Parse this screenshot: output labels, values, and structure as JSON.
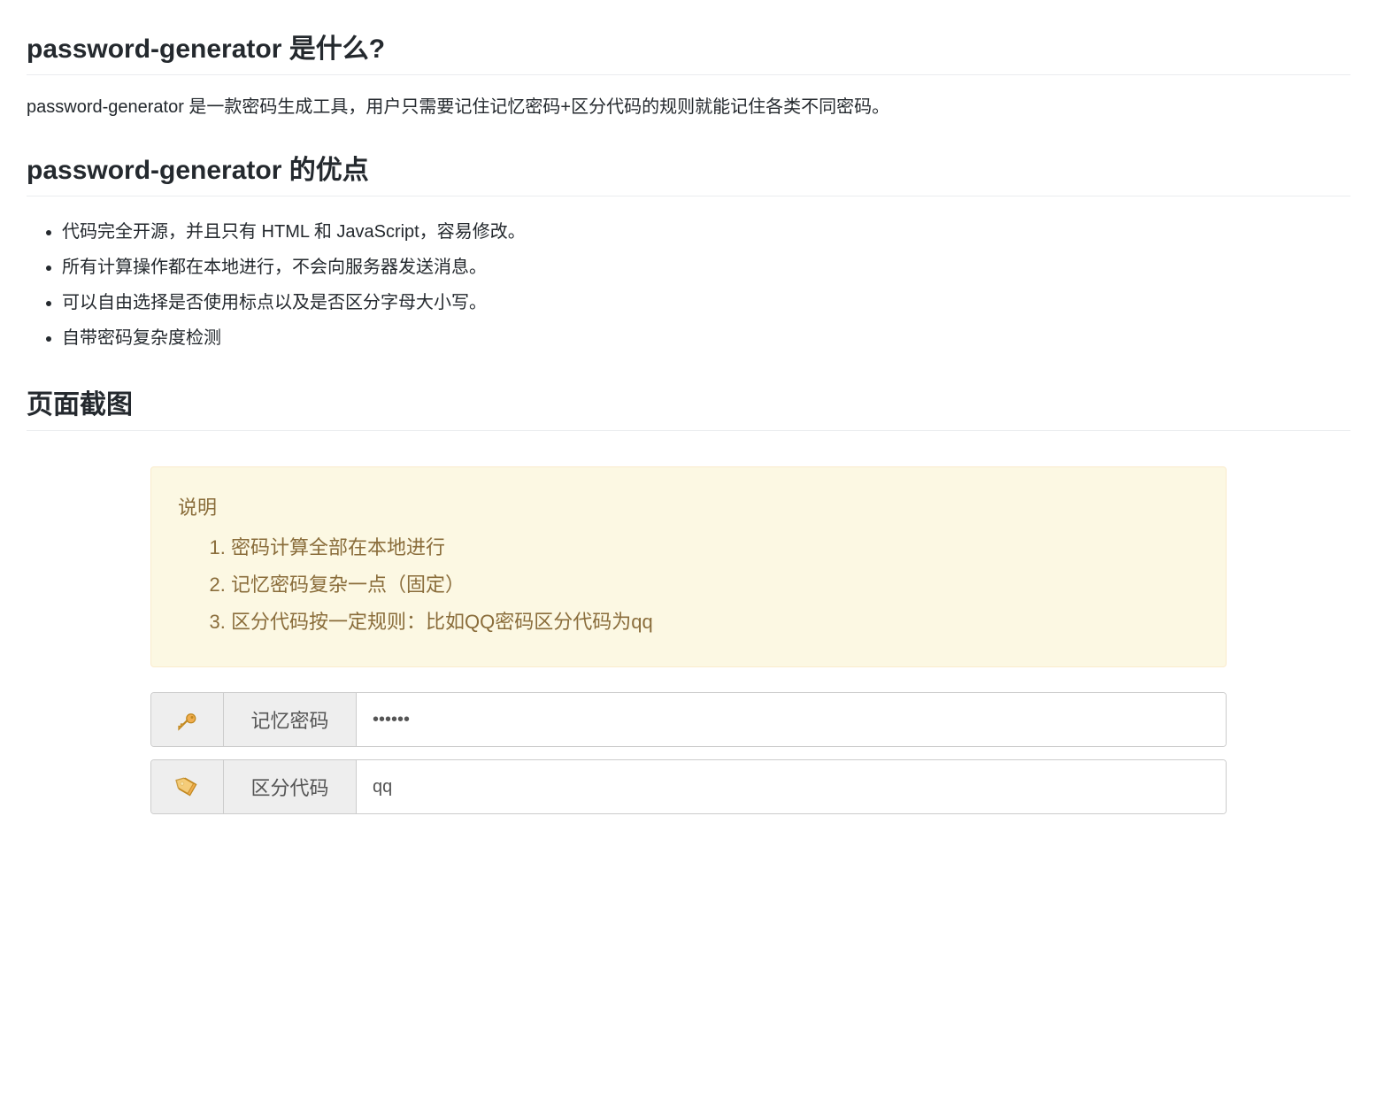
{
  "section1": {
    "heading": "password-generator 是什么?",
    "description": "password-generator 是一款密码生成工具，用户只需要记住记忆密码+区分代码的规则就能记住各类不同密码。"
  },
  "section2": {
    "heading": "password-generator 的优点",
    "advantages": [
      "代码完全开源，并且只有 HTML 和 JavaScript，容易修改。",
      "所有计算操作都在本地进行，不会向服务器发送消息。",
      "可以自由选择是否使用标点以及是否区分字母大小写。",
      "自带密码复杂度检测"
    ]
  },
  "section3": {
    "heading": "页面截图"
  },
  "infobox": {
    "title": "说明",
    "items": [
      "密码计算全部在本地进行",
      "记忆密码复杂一点（固定）",
      "区分代码按一定规则：比如QQ密码区分代码为qq"
    ]
  },
  "inputs": {
    "memory_label": "记忆密码",
    "memory_value": "••••••",
    "distinguish_label": "区分代码",
    "distinguish_value": "qq"
  }
}
